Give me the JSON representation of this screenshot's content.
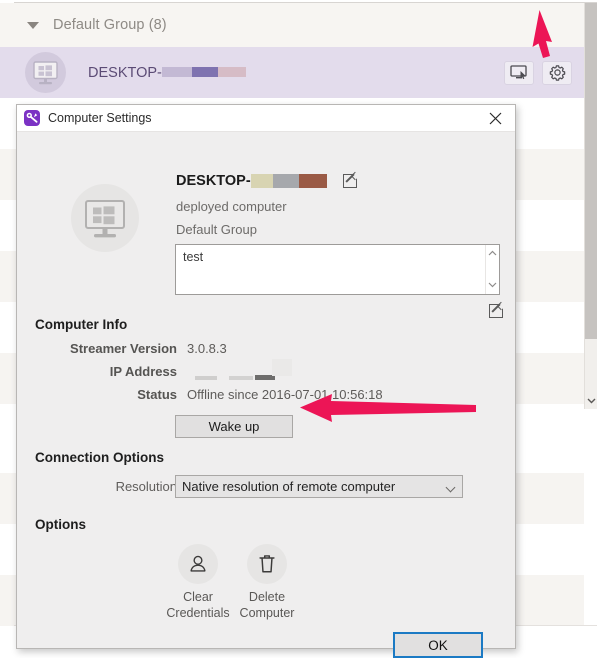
{
  "background": {
    "group": {
      "caret": "triangle-down-icon",
      "label": "Default Group (8)"
    },
    "computer_row": {
      "avatar": "windows-monitor-icon",
      "name_prefix": "DESKTOP-",
      "redacted": true,
      "connect_icon": "monitor-cursor-icon",
      "settings_icon": "gear-icon"
    },
    "scrollbar": {
      "down_arrow": "chevron-down-icon"
    }
  },
  "dialog": {
    "title": "Computer Settings",
    "title_icon": "splashtop-wrench-icon",
    "close_icon": "close-icon",
    "avatar_icon": "windows-monitor-icon",
    "computer_name": "DESKTOP-",
    "name_edit_icon": "pencil-edit-icon",
    "description": "deployed computer",
    "group": "Default Group",
    "notes": {
      "value": "test",
      "scroll_up_icon": "chevron-up-icon",
      "scroll_down_icon": "chevron-down-icon",
      "edit_icon": "pencil-edit-icon"
    },
    "computer_info": {
      "heading": "Computer Info",
      "rows": [
        {
          "label": "Streamer Version",
          "value": "3.0.8.3"
        },
        {
          "label": "IP Address",
          "value": ""
        },
        {
          "label": "Status",
          "value": "Offline since 2016-07-01 10:56:18"
        }
      ],
      "wake_button": "Wake up"
    },
    "connection_options": {
      "heading": "Connection Options",
      "resolution_label": "Resolution",
      "resolution_value": "Native resolution of remote computer",
      "resolution_caret": "chevron-down-icon"
    },
    "options": {
      "heading": "Options",
      "items": [
        {
          "icon": "person-icon",
          "line1": "Clear",
          "line2": "Credentials"
        },
        {
          "icon": "trash-icon",
          "line1": "Delete",
          "line2": "Computer"
        }
      ]
    },
    "ok_button": "OK"
  },
  "annotations": {
    "arrow_color": "#ec1556",
    "arrows": [
      {
        "name": "arrow-pointing-gear",
        "direction": "down"
      },
      {
        "name": "arrow-pointing-wake-up",
        "direction": "left"
      }
    ]
  }
}
